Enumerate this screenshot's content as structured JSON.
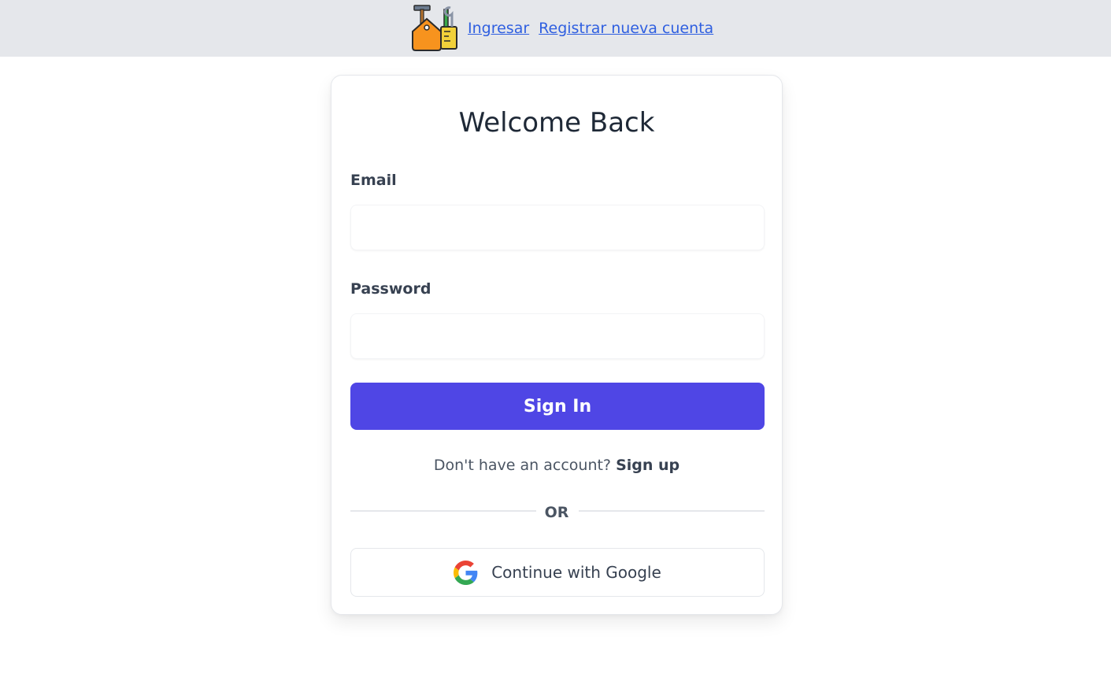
{
  "header": {
    "logo_icon": "toolbox-icon",
    "links": [
      "Ingresar",
      "Registrar nueva cuenta"
    ],
    "link_color": "#2f5fe0"
  },
  "form": {
    "title": "Welcome Back",
    "email_label": "Email",
    "email_value": "",
    "password_label": "Password",
    "password_value": "",
    "submit_label": "Sign In",
    "submit_color": "#4f46e5",
    "signup_prompt": "Don't have an account?",
    "signup_link": "Sign up",
    "divider_text": "OR",
    "google_label": "Continue with Google",
    "google_icon": "google-icon"
  }
}
